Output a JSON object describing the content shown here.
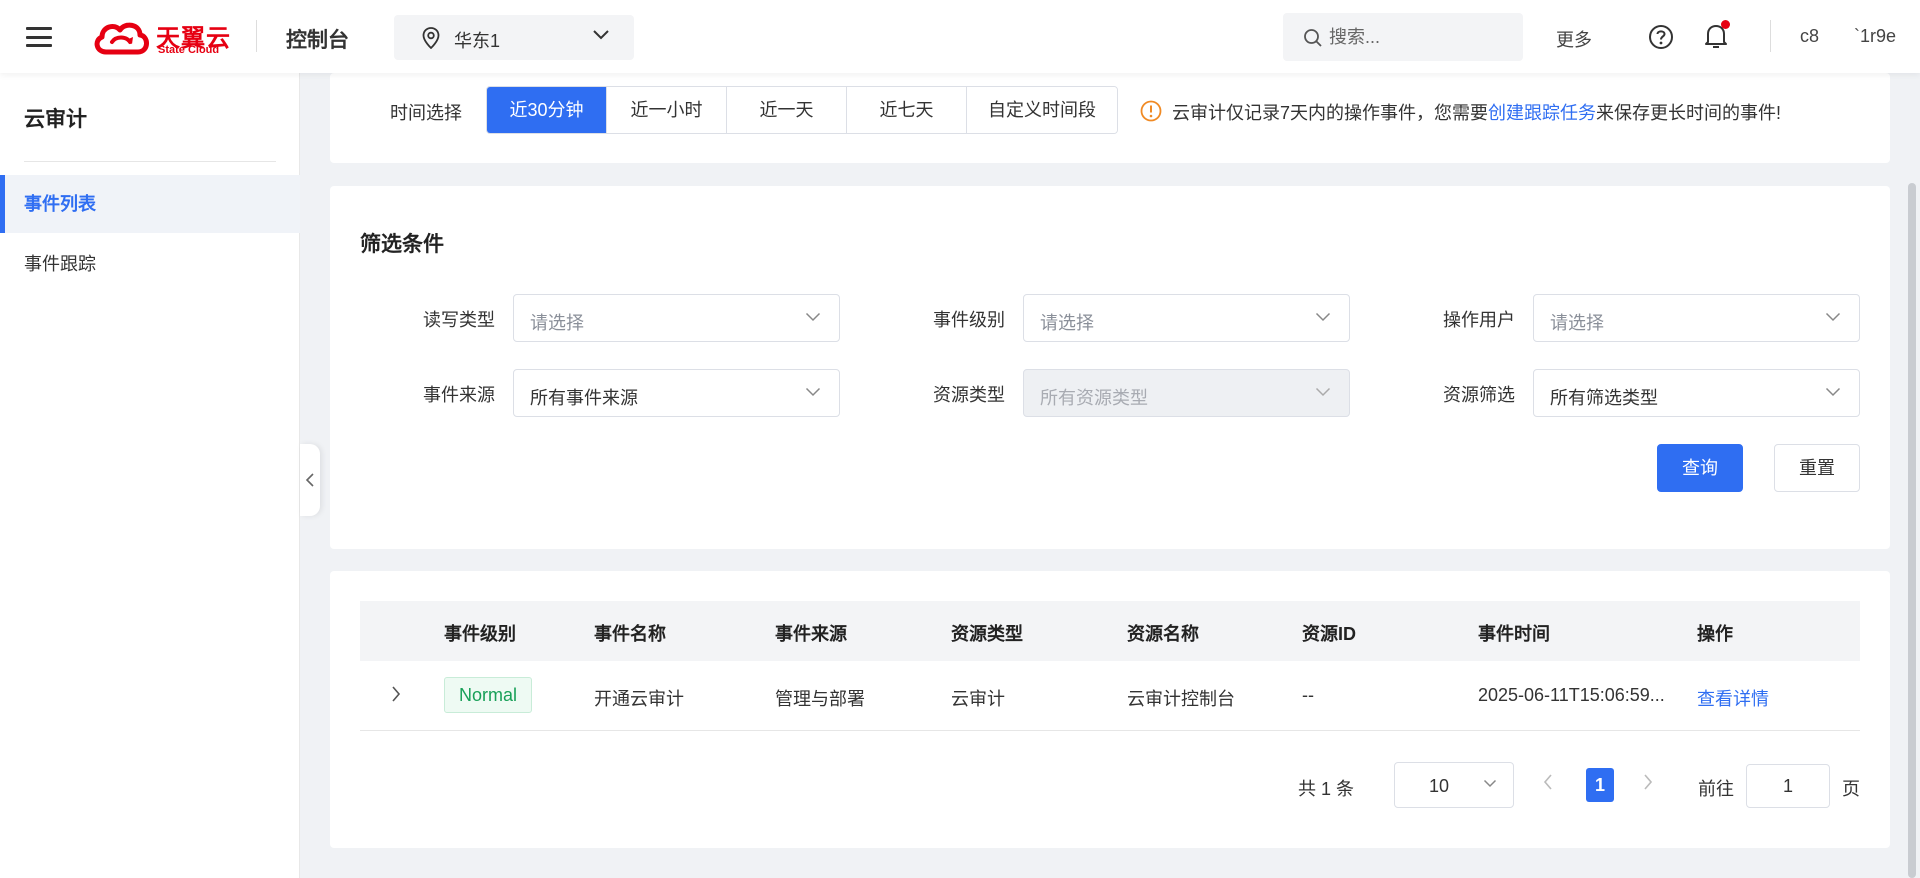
{
  "header": {
    "logo_cn": "天翼云",
    "logo_en": "State Cloud",
    "console_title": "控制台",
    "region": "华东1",
    "search_placeholder": "搜索...",
    "more": "更多",
    "user_short": "c8",
    "user_name": "`1r9e"
  },
  "sidebar": {
    "title": "云审计",
    "items": [
      {
        "label": "事件列表",
        "active": true
      },
      {
        "label": "事件跟踪",
        "active": false
      }
    ]
  },
  "time_filter": {
    "label": "时间选择",
    "options": [
      "近30分钟",
      "近一小时",
      "近一天",
      "近七天",
      "自定义时间段"
    ],
    "selected": "近30分钟",
    "notice_prefix": "云审计仅记录7天内的操作事件，您需要",
    "notice_link": "创建跟踪任务",
    "notice_suffix": "来保存更长时间的事件!"
  },
  "filters": {
    "title": "筛选条件",
    "fields": [
      {
        "label": "读写类型",
        "value": "请选择",
        "placeholder": true
      },
      {
        "label": "事件级别",
        "value": "请选择",
        "placeholder": true
      },
      {
        "label": "操作用户",
        "value": "请选择",
        "placeholder": true
      },
      {
        "label": "事件来源",
        "value": "所有事件来源",
        "placeholder": false
      },
      {
        "label": "资源类型",
        "value": "所有资源类型",
        "placeholder": false,
        "disabled": true
      },
      {
        "label": "资源筛选",
        "value": "所有筛选类型",
        "placeholder": false
      }
    ],
    "query_button": "查询",
    "reset_button": "重置"
  },
  "table": {
    "columns": [
      "事件级别",
      "事件名称",
      "事件来源",
      "资源类型",
      "资源名称",
      "资源ID",
      "事件时间",
      "操作"
    ],
    "rows": [
      {
        "level": "Normal",
        "name": "开通云审计",
        "source": "管理与部署",
        "resource_type": "云审计",
        "resource_name": "云审计控制台",
        "resource_id": "--",
        "time": "2025-06-11T15:06:59...",
        "action": "查看详情"
      }
    ]
  },
  "pagination": {
    "total": "共 1 条",
    "page_size": "10",
    "current_page": "1",
    "goto_label": "前往",
    "goto_value": "1",
    "page_unit": "页"
  },
  "colors": {
    "primary": "#2f6ef2",
    "brand_red": "#e60012",
    "success": "#18a058",
    "warning": "#f08a24"
  }
}
